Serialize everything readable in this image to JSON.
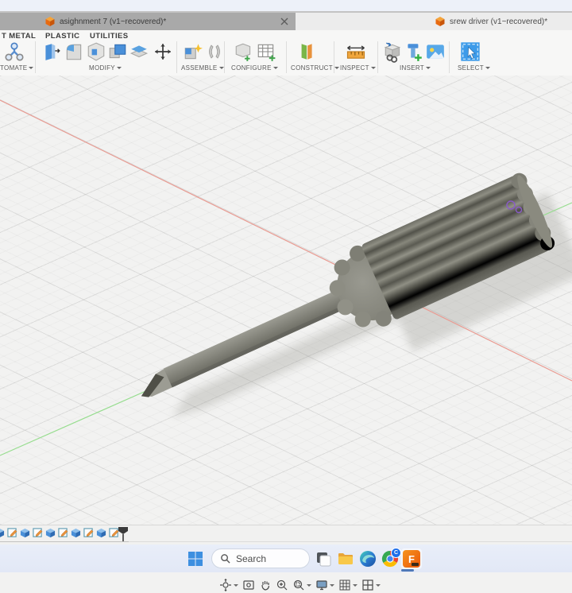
{
  "window": {
    "tabs": [
      {
        "label": "asighnment 7 (v1~recovered)*",
        "active": true
      },
      {
        "label": "srew driver (v1~recovered)*",
        "active": false
      }
    ]
  },
  "ribbon": {
    "context_tabs": [
      "T METAL",
      "PLASTIC",
      "UTILITIES"
    ],
    "groups": [
      {
        "label": "TOMATE"
      },
      {
        "label": "MODIFY"
      },
      {
        "label": "ASSEMBLE"
      },
      {
        "label": "CONFIGURE"
      },
      {
        "label": "CONSTRUCT"
      },
      {
        "label": "INSPECT"
      },
      {
        "label": "INSERT"
      },
      {
        "label": "SELECT"
      }
    ]
  },
  "viewport": {
    "model": "screwdriver (flat-head, fluted handle)",
    "axes": {
      "x_color": "#e99b92",
      "y_color": "#98dd90"
    },
    "sketch_point_color": "#8a5bc8",
    "nav_tools": [
      "orbit",
      "look-at",
      "pan",
      "zoom",
      "fit",
      "display-settings",
      "grid-and-snaps",
      "viewports"
    ]
  },
  "timeline": {
    "features": [
      "extrude",
      "sketch",
      "extrude",
      "sketch",
      "extrude",
      "sketch",
      "extrude",
      "sketch",
      "extrude",
      "sketch"
    ]
  },
  "taskbar": {
    "search_placeholder": "Search",
    "chrome_badge": "C",
    "fusion_label": "F",
    "apps": [
      "start",
      "search",
      "task-view",
      "file-explorer",
      "edge",
      "chrome",
      "fusion-360"
    ]
  }
}
